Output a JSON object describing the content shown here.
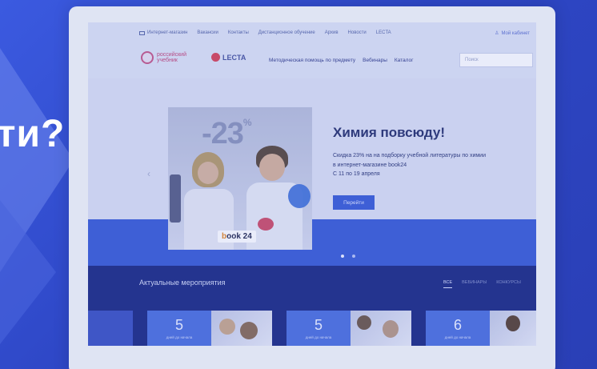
{
  "background": {
    "headline": "ти?"
  },
  "site": {
    "topbar": {
      "items": [
        "Интернет-магазин",
        "Вакансии",
        "Контакты",
        "Дистанционное обучение",
        "Архив",
        "Новости",
        "LECTA"
      ],
      "account": "Мой кабинет"
    },
    "logos": {
      "logo1": [
        "российский",
        "учебник"
      ],
      "logo2": "LECTA"
    },
    "nav": [
      "Методическая помощь по предмету",
      "Вебинары",
      "Каталог"
    ],
    "search_placeholder": "Поиск",
    "hero": {
      "promo": {
        "discount": "-23",
        "percent": "%",
        "brand_prefix": "b",
        "brand_rest": "ook 24"
      },
      "title": "Химия повсюду!",
      "description_line1": "Скидка 23% на на подборку учебной литературы по химии",
      "description_line2": "в интернет-магазине book24",
      "description_line3": "С 11 по 19 апреля",
      "button": "Перейти"
    },
    "events": {
      "title": "Актуальные мероприятия",
      "tabs": [
        "ВСЕ",
        "ВЕБИНАРЫ",
        "КОНКУРСЫ"
      ],
      "cards": [
        {
          "number": "5",
          "caption": "дней до начала"
        },
        {
          "number": "5",
          "caption": "дней до начала"
        },
        {
          "number": "6",
          "caption": "дней до начала"
        }
      ]
    }
  },
  "colors": {
    "page_bg": "#2f48c8",
    "accent": "#3d5fd6",
    "events_bg": "#1f2e86"
  }
}
